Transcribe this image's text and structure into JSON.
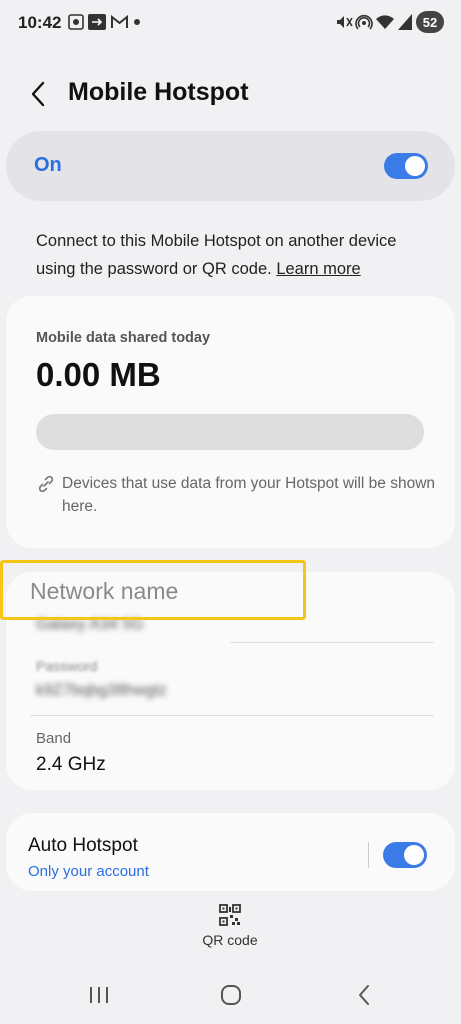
{
  "status_bar": {
    "time": "10:42",
    "battery": "52",
    "left_icons": [
      "screenshot-icon",
      "cast-icon",
      "gmail-icon",
      "dot-icon"
    ],
    "right_icons": [
      "mute-icon",
      "hotspot-icon",
      "wifi-icon",
      "signal-icon"
    ]
  },
  "header": {
    "title": "Mobile Hotspot"
  },
  "master_toggle": {
    "label": "On",
    "state": true
  },
  "description": {
    "text": "Connect to this Mobile Hotspot on another device using the password or QR code.",
    "link": "Learn more"
  },
  "data_card": {
    "label": "Mobile data shared today",
    "value": "0.00 MB",
    "progress": 0,
    "devices_text": "Devices that use data from your Hotspot will be shown here."
  },
  "network": {
    "name_label": "Network name",
    "name_value": "Galaxy A34 5G",
    "password_label": "Password",
    "password_value": "k9Z7bqbg38hwgtz",
    "band_label": "Band",
    "band_value": "2.4 GHz"
  },
  "auto_hotspot": {
    "title": "Auto Hotspot",
    "subtitle": "Only your account",
    "state": true
  },
  "qr": {
    "label": "QR code"
  },
  "nav": [
    "recents-icon",
    "home-icon",
    "back-icon"
  ],
  "colors": {
    "accent": "#3b7be8",
    "highlight": "#f5c518",
    "background": "#f1f1f3"
  }
}
